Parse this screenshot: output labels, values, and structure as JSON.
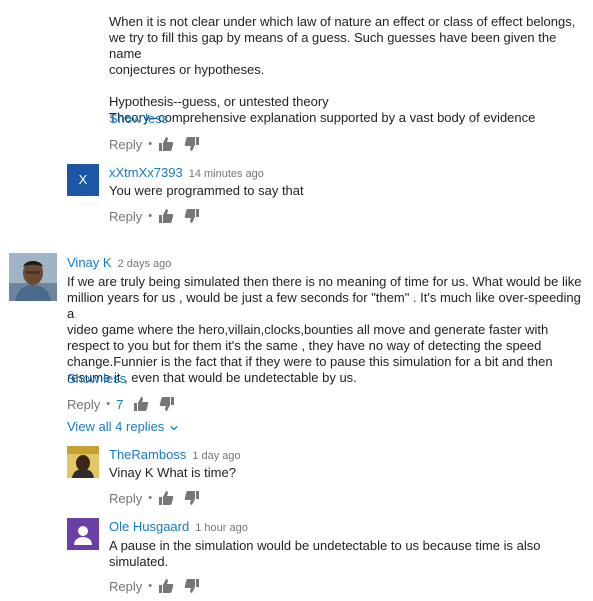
{
  "top_comment": {
    "body": "When it is not clear under which law of nature an effect or class of effect belongs,\nwe try to fill this gap by means of a guess. Such guesses have been given the name\nconjectures or hypotheses.\n\nHypothesis--guess, or untested theory\nTheory--comprehensive explanation supported by a vast body of evidence",
    "show_less": "Show less",
    "reply": "Reply"
  },
  "reply_xxtm": {
    "avatar_letter": "X",
    "author": "xXtmXx7393",
    "time": "14 minutes ago",
    "body": "You were programmed to say that",
    "reply": "Reply"
  },
  "comment_vinay": {
    "author": "Vinay K",
    "time": "2 days ago",
    "body": "If we are truly being simulated then there is no meaning of time for us. What would be like\nmillion years for us , would be just a few seconds for \"them\" . It's much like over-speeding a\nvideo game where the hero,villain,clocks,bounties all move and generate faster with\nrespect to you but for them it's the same , they have no way of detecting the speed\nchange.Funnier is the fact that if they were to pause this simulation for a bit and then\nresume it , even that would be undetectable by us.",
    "show_less": "Show less",
    "reply": "Reply",
    "like_count": "7",
    "view_replies": "View all 4 replies"
  },
  "reply_ramboss": {
    "author": "TheRamboss",
    "time": "1 day ago",
    "body": "Vinay K What is time?",
    "reply": "Reply"
  },
  "reply_ole": {
    "author": "Ole Husgaard",
    "time": "1 hour ago",
    "body": "A pause in the simulation would be undetectable to us because time is also\nsimulated.",
    "reply": "Reply"
  },
  "colors": {
    "link": "#167ac6",
    "text": "#222222",
    "meta": "#767676",
    "avatar_x": "#1d56a5",
    "avatar_ole": "#6a3fa6"
  },
  "icons": {
    "like": "thumbs-up-icon",
    "dislike": "thumbs-down-icon",
    "chevron": "chevron-down-icon"
  }
}
